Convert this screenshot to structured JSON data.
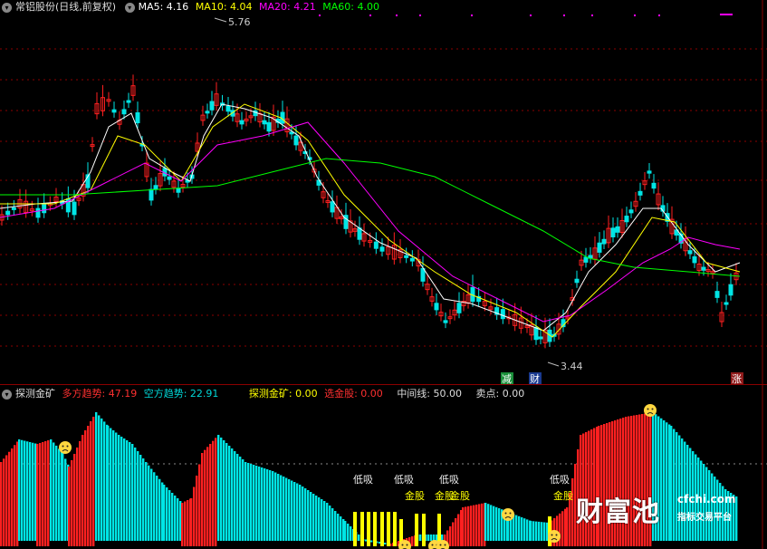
{
  "main": {
    "title": "常铝股份(日线,前复权)",
    "ma": [
      {
        "label": "MA5: 4.16",
        "color": "#ffffff"
      },
      {
        "label": "MA10: 4.04",
        "color": "#ffff00"
      },
      {
        "label": "MA20: 4.21",
        "color": "#ff00ff"
      },
      {
        "label": "MA60: 4.00",
        "color": "#00ff00"
      }
    ],
    "high_label": "5.76",
    "low_label": "3.44",
    "markers": [
      {
        "text": "减",
        "bg": "#1a8f3a",
        "color": "#ffffff"
      },
      {
        "text": "财",
        "bg": "#1a3a8f",
        "color": "#ffffff"
      },
      {
        "text": "涨",
        "bg": "#8f1a1a",
        "color": "#ffffff"
      }
    ]
  },
  "indicator": {
    "title": "探测金矿",
    "fields": [
      {
        "label": "多方趋势: 47.19",
        "color": "#ff3030"
      },
      {
        "label": "空方趋势: 22.91",
        "color": "#00d8d8"
      },
      {
        "label": "探测金矿: 0.00",
        "color": "#ffff00"
      },
      {
        "label": "选金股: 0.00",
        "color": "#ff3030"
      },
      {
        "label": "中间线: 50.00",
        "color": "#dddddd"
      },
      {
        "label": "卖点: 0.00",
        "color": "#dddddd"
      }
    ],
    "annotations": [
      "低吸",
      "低吸",
      "低吸",
      "低吸",
      "金股",
      "金股",
      "金股",
      "金股"
    ]
  },
  "watermark": {
    "name": "财富池",
    "url": "cfchi.com",
    "sub": "指标交易平台"
  },
  "colors": {
    "up": "#ff2020",
    "down": "#00e5e5",
    "gold": "#ffff00",
    "grid": "#8b0000"
  }
}
